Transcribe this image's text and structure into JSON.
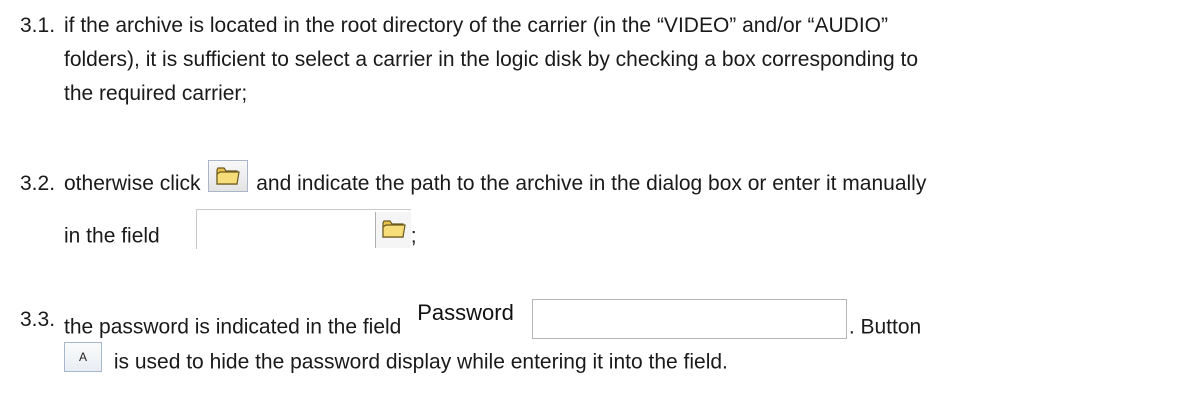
{
  "items": [
    {
      "number": "3.1.",
      "lines": [
        "if the archive is located in the root directory of the carrier (in the “VIDEO” and/or “AUDIO”",
        "folders), it is sufficient to select a carrier in the logic disk by checking a box corresponding to",
        "the required carrier;"
      ]
    },
    {
      "number": "3.2.",
      "text_before_button": "otherwise click",
      "text_after_button": "and indicate the path to the archive in the dialog box or enter it manually",
      "line2_text": "in the field",
      "line2_end": ";"
    },
    {
      "number": "3.3.",
      "text_before_field": "the password is indicated in the field",
      "password_label": "Password",
      "text_after_field": ". Button",
      "a_button_label": "A",
      "line2_text": "is used to hide the password display while entering it into the field."
    }
  ],
  "icons": {
    "folder_button": "folder-icon",
    "field_folder_button": "folder-icon"
  },
  "colors": {
    "folder_fill": "#f3d36b",
    "folder_edge": "#7a6a2a",
    "button_border": "#a9b6c7"
  }
}
